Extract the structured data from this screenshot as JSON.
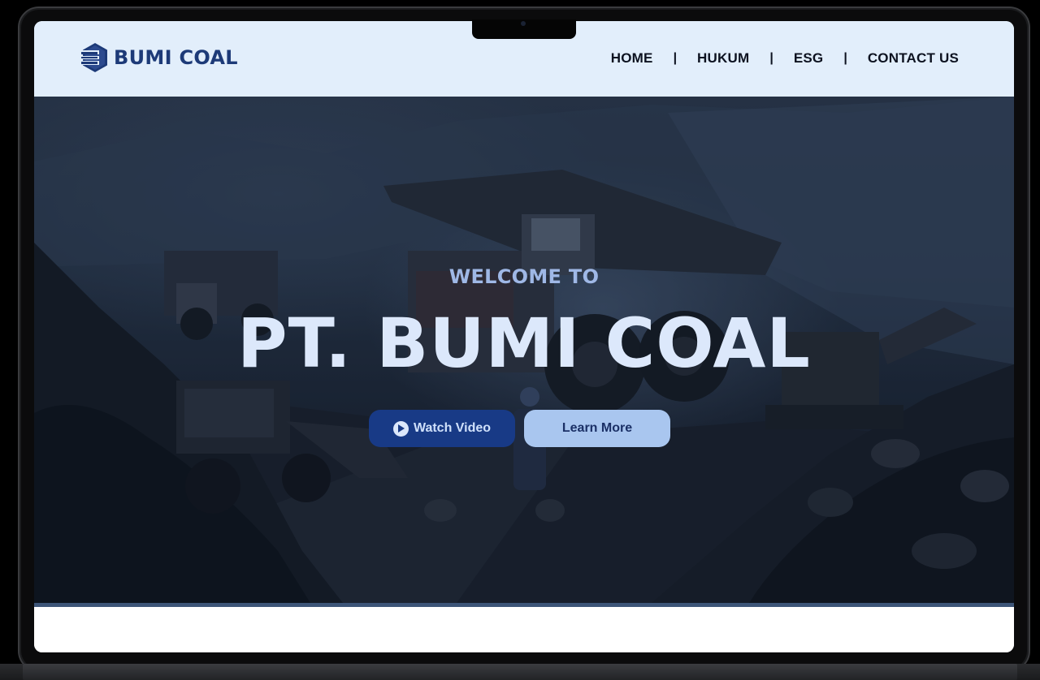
{
  "brand": {
    "name": "BUMI COAL",
    "logo_icon": "letter-b-hexagon-icon",
    "colors": {
      "primary": "#1d3a78",
      "navbar_bg": "#e2eefb"
    }
  },
  "nav": {
    "items": [
      {
        "label": "HOME"
      },
      {
        "label": "HUKUM"
      },
      {
        "label": "ESG"
      },
      {
        "label": "CONTACT US"
      }
    ],
    "separator": "|"
  },
  "hero": {
    "eyebrow": "WELCOME TO",
    "title": "PT. BUMI COAL",
    "background": "coal-mine-dump-trucks-image",
    "buttons": {
      "watch_video": {
        "label": "Watch Video",
        "icon": "play-circle-icon"
      },
      "learn_more": {
        "label": "Learn More"
      }
    }
  }
}
